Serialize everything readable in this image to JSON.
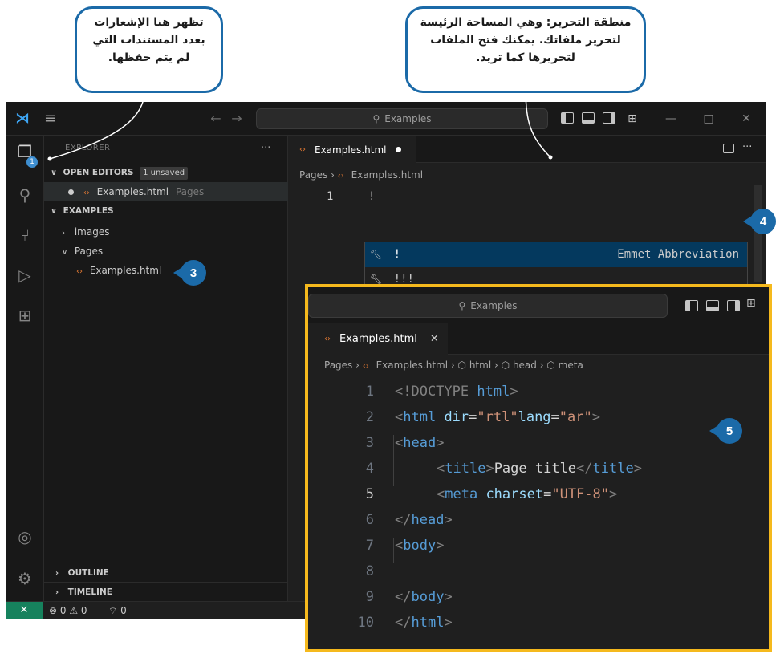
{
  "callouts": {
    "notifications": "تظهر هنا الإشعارات بعدد المستندات التي لم يتم حفظها.",
    "editor_area": "منطقة التحرير: وهي المساحة الرئيسة لتحرير ملفاتك. يمكنك فتح الملفات لتحريرها كما تريد."
  },
  "badges": {
    "explorer_file": "3",
    "suggestion": "4",
    "result": "5"
  },
  "titlebar": {
    "search": "Examples"
  },
  "activitybar": {
    "explorer_badge": "1"
  },
  "sidebar": {
    "title": "EXPLORER",
    "more": "···",
    "open_editors": {
      "label": "OPEN EDITORS",
      "unsaved": "1 unsaved"
    },
    "open_file": {
      "name": "Examples.html",
      "folder": "Pages"
    },
    "examples_label": "EXAMPLES",
    "images_label": "images",
    "pages_label": "Pages",
    "file_label": "Examples.html",
    "outline": "OUTLINE",
    "timeline": "TIMELINE"
  },
  "editor": {
    "tab_name": "Examples.html",
    "breadcrumb": {
      "folder": "Pages",
      "file": "Examples.html"
    },
    "line_number": "1",
    "line_text": "!",
    "suggestions": [
      {
        "label": "!",
        "detail": "Emmet Abbreviation"
      },
      {
        "label": "!!!"
      }
    ]
  },
  "statusbar": {
    "remote": "✕",
    "problems": "⊗ 0 ⚠ 0",
    "ports": "⌔ 0"
  },
  "inset": {
    "search": "Examples",
    "tab_name": "Examples.html",
    "tab_close": "✕",
    "breadcrumb": {
      "folder": "Pages",
      "file": "Examples.html",
      "html": "html",
      "head": "head",
      "meta": "meta"
    },
    "code": {
      "l1": {
        "n": "1",
        "a": "<!DOCTYPE",
        "b": " html",
        "c": ">"
      },
      "l2": {
        "n": "2",
        "a": "<",
        "tag": "html",
        "attr1": " dir",
        "eq1": "=",
        "val1": "\"rtl\"",
        "attr2": "lang",
        "eq2": "=",
        "val2": "\"ar\"",
        "end": ">"
      },
      "l3": {
        "n": "3",
        "a": "<",
        "tag": "head",
        "end": ">"
      },
      "l4": {
        "n": "4",
        "a": "<",
        "tag": "title",
        "b": ">",
        "text": "Page title",
        "c": "</",
        "tag2": "title",
        "end": ">"
      },
      "l5": {
        "n": "5",
        "a": "<",
        "tag": "meta",
        "attr": " charset",
        "eq": "=",
        "val": "\"UTF-8\"",
        "end": ">"
      },
      "l6": {
        "n": "6",
        "a": "</",
        "tag": "head",
        "end": ">"
      },
      "l7": {
        "n": "7",
        "a": "<",
        "tag": "body",
        "end": ">"
      },
      "l8": {
        "n": "8"
      },
      "l9": {
        "n": "9",
        "a": "</",
        "tag": "body",
        "end": ">"
      },
      "l10": {
        "n": "10",
        "a": "</",
        "tag": "html",
        "end": ">"
      }
    }
  },
  "colors": {
    "accent": "#1b6aa8",
    "highlight": "#f5b91d",
    "editor_bg": "#1f1f1f"
  }
}
